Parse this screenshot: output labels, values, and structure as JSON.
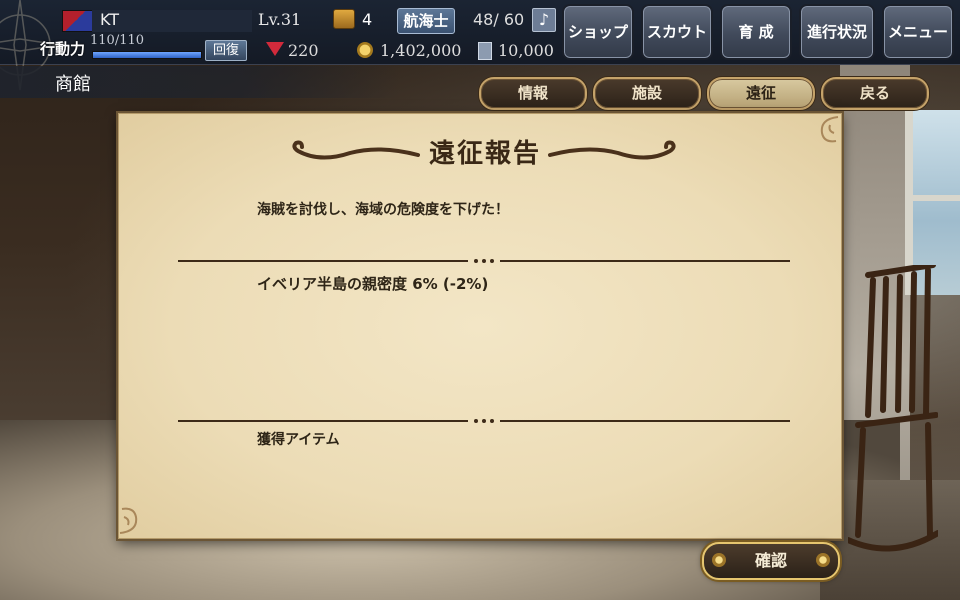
{
  "player": {
    "name": "KT",
    "level": "Lv.31",
    "chest_count": "4",
    "rank": "航海士",
    "crew": "48/ 60",
    "stamina_label": "行動力",
    "stamina_text": "110/110",
    "stamina_fraction": 1.0,
    "recover_label": "回復",
    "gems": "220",
    "coins": "1,402,000",
    "tickets": "10,000"
  },
  "menu": {
    "shop": "ショップ",
    "scout": "スカウト",
    "train": "育 成",
    "progress": "進行状況",
    "menu": "メニュー"
  },
  "location": "商館",
  "tabs": [
    {
      "label": "情報"
    },
    {
      "label": "施設"
    },
    {
      "label": "遠征"
    },
    {
      "label": "戻る"
    }
  ],
  "active_tab": "遠征",
  "report": {
    "title": "遠征報告",
    "message": "海賊を討伐し、海域の危険度を下げた！",
    "affinity": "イベリア半島の親密度 6% (-2%)",
    "items_label": "獲得アイテム"
  },
  "confirm_label": "確認",
  "colors": {
    "parchment": "#ecdcb6",
    "gold_border": "#e6c66f",
    "hud_bg": "#1b2433"
  }
}
